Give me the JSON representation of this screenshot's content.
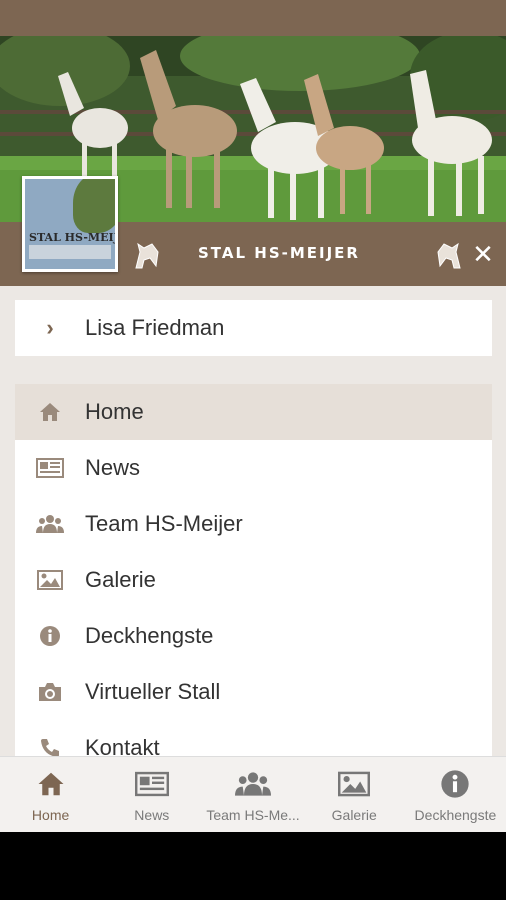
{
  "brand": {
    "title": "STAL  HS-MEIJER",
    "logo_text": "STAL HS-MEIJER"
  },
  "user": {
    "name": "Lisa Friedman"
  },
  "menu": [
    {
      "label": "Home",
      "icon": "home-icon",
      "active": true
    },
    {
      "label": "News",
      "icon": "newspaper-icon"
    },
    {
      "label": "Team HS-Meijer",
      "icon": "users-icon"
    },
    {
      "label": "Galerie",
      "icon": "image-icon"
    },
    {
      "label": "Deckhengste",
      "icon": "info-icon"
    },
    {
      "label": "Virtueller Stall",
      "icon": "camera-icon"
    },
    {
      "label": "Kontakt",
      "icon": "phone-icon"
    }
  ],
  "bottom_nav": [
    {
      "label": "Home",
      "icon": "home-icon",
      "active": true
    },
    {
      "label": "News",
      "icon": "newspaper-icon"
    },
    {
      "label": "Team HS-Me...",
      "icon": "users-icon"
    },
    {
      "label": "Galerie",
      "icon": "image-icon"
    },
    {
      "label": "Deckhengste",
      "icon": "info-icon"
    }
  ],
  "colors": {
    "brand_brown": "#7d6652",
    "active_bg": "#e6dfd8",
    "menu_bg": "#ece8e4"
  }
}
